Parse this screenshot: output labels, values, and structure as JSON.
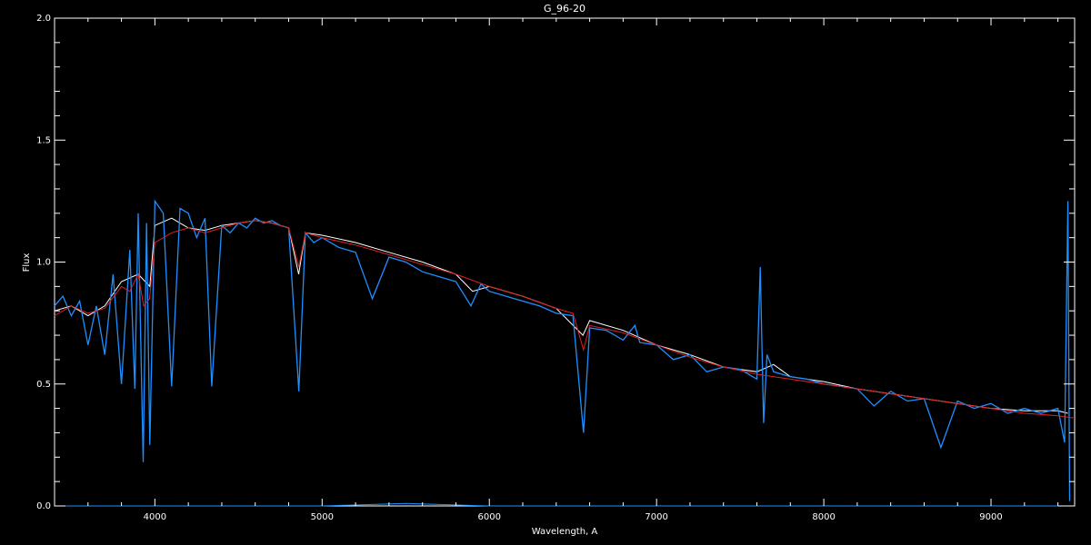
{
  "chart_data": {
    "type": "line",
    "title": "G_96-20",
    "xlabel": "Wavelength, A",
    "ylabel": "Flux",
    "xlim": [
      3400,
      9500
    ],
    "ylim": [
      0.0,
      2.0
    ],
    "xticks": [
      4000,
      5000,
      6000,
      7000,
      8000,
      9000
    ],
    "xtick_labels": [
      "4000",
      "5000",
      "6000",
      "7000",
      "8000",
      "9000"
    ],
    "yticks": [
      0.0,
      0.5,
      1.0,
      1.5,
      2.0
    ],
    "ytick_labels": [
      "0.0",
      "0.5",
      "1.0",
      "1.5",
      "2.0"
    ],
    "grid": false,
    "background": "#000000",
    "series": [
      {
        "color": "#ffffff",
        "x": [
          3400,
          3500,
          3600,
          3700,
          3800,
          3900,
          3970,
          4000,
          4100,
          4200,
          4300,
          4400,
          4500,
          4600,
          4700,
          4800,
          4860,
          4900,
          5000,
          5200,
          5400,
          5600,
          5800,
          5900,
          6000,
          6200,
          6400,
          6560,
          6600,
          6800,
          7000,
          7200,
          7400,
          7600,
          7700,
          7800,
          8000,
          8200,
          8400,
          8600,
          8800,
          9000,
          9200,
          9400,
          9460
        ],
        "y": [
          0.8,
          0.82,
          0.78,
          0.82,
          0.92,
          0.95,
          0.9,
          1.15,
          1.18,
          1.14,
          1.13,
          1.15,
          1.16,
          1.17,
          1.16,
          1.14,
          0.95,
          1.12,
          1.11,
          1.08,
          1.04,
          1.0,
          0.95,
          0.88,
          0.9,
          0.86,
          0.81,
          0.7,
          0.76,
          0.72,
          0.66,
          0.62,
          0.57,
          0.55,
          0.58,
          0.53,
          0.51,
          0.48,
          0.46,
          0.44,
          0.42,
          0.4,
          0.39,
          0.39,
          0.38
        ]
      },
      {
        "color": "#1e8fff",
        "x": [
          3400,
          3450,
          3500,
          3550,
          3600,
          3650,
          3700,
          3750,
          3800,
          3850,
          3880,
          3900,
          3930,
          3950,
          3970,
          4000,
          4050,
          4100,
          4150,
          4200,
          4250,
          4300,
          4340,
          4400,
          4450,
          4500,
          4550,
          4600,
          4650,
          4700,
          4750,
          4800,
          4861,
          4900,
          4950,
          5000,
          5100,
          5200,
          5300,
          5400,
          5500,
          5600,
          5700,
          5800,
          5890,
          5950,
          6000,
          6100,
          6200,
          6300,
          6400,
          6500,
          6563,
          6600,
          6700,
          6800,
          6870,
          6900,
          7000,
          7100,
          7200,
          7300,
          7400,
          7500,
          7600,
          7620,
          7640,
          7660,
          7700,
          7800,
          7900,
          8000,
          8100,
          8200,
          8300,
          8400,
          8500,
          8600,
          8700,
          8800,
          8900,
          9000,
          9100,
          9200,
          9300,
          9400,
          9440,
          9460,
          9470
        ],
        "y": [
          0.82,
          0.86,
          0.78,
          0.84,
          0.66,
          0.82,
          0.62,
          0.95,
          0.5,
          1.05,
          0.48,
          1.2,
          0.18,
          1.16,
          0.25,
          1.25,
          1.2,
          0.49,
          1.22,
          1.2,
          1.1,
          1.18,
          0.49,
          1.15,
          1.12,
          1.16,
          1.14,
          1.18,
          1.16,
          1.17,
          1.15,
          1.14,
          0.47,
          1.12,
          1.08,
          1.1,
          1.06,
          1.04,
          0.85,
          1.02,
          1.0,
          0.96,
          0.94,
          0.92,
          0.82,
          0.91,
          0.88,
          0.86,
          0.84,
          0.82,
          0.79,
          0.78,
          0.3,
          0.73,
          0.72,
          0.68,
          0.74,
          0.67,
          0.66,
          0.6,
          0.62,
          0.55,
          0.57,
          0.56,
          0.52,
          0.98,
          0.34,
          0.62,
          0.55,
          0.53,
          0.52,
          0.5,
          0.49,
          0.48,
          0.41,
          0.47,
          0.43,
          0.44,
          0.24,
          0.43,
          0.4,
          0.42,
          0.38,
          0.4,
          0.38,
          0.4,
          0.26,
          1.25,
          0.02
        ]
      },
      {
        "color": "#e02020",
        "x": [
          3400,
          3500,
          3600,
          3700,
          3800,
          3850,
          3900,
          3933,
          3968,
          4000,
          4100,
          4200,
          4300,
          4400,
          4500,
          4600,
          4700,
          4800,
          4861,
          4900,
          5000,
          5200,
          5400,
          5600,
          5800,
          6000,
          6200,
          6400,
          6500,
          6563,
          6600,
          6800,
          7000,
          7200,
          7400,
          7600,
          7800,
          8000,
          8200,
          8400,
          8600,
          8800,
          9000,
          9200,
          9400,
          9500
        ],
        "y": [
          0.78,
          0.82,
          0.79,
          0.81,
          0.9,
          0.88,
          0.95,
          0.82,
          0.85,
          1.08,
          1.12,
          1.14,
          1.12,
          1.14,
          1.16,
          1.17,
          1.16,
          1.14,
          0.98,
          1.12,
          1.1,
          1.07,
          1.03,
          0.99,
          0.95,
          0.9,
          0.86,
          0.81,
          0.79,
          0.64,
          0.74,
          0.71,
          0.66,
          0.61,
          0.57,
          0.54,
          0.52,
          0.5,
          0.48,
          0.46,
          0.44,
          0.42,
          0.4,
          0.38,
          0.37,
          0.36
        ]
      },
      {
        "color": "#1e8fff",
        "x": [
          3400,
          4000,
          5000,
          5500,
          6000,
          7000,
          8000,
          9000,
          9400
        ],
        "y": [
          0.0,
          0.0,
          0.0,
          0.01,
          0.0,
          0.0,
          0.0,
          0.0,
          0.0
        ]
      }
    ]
  }
}
